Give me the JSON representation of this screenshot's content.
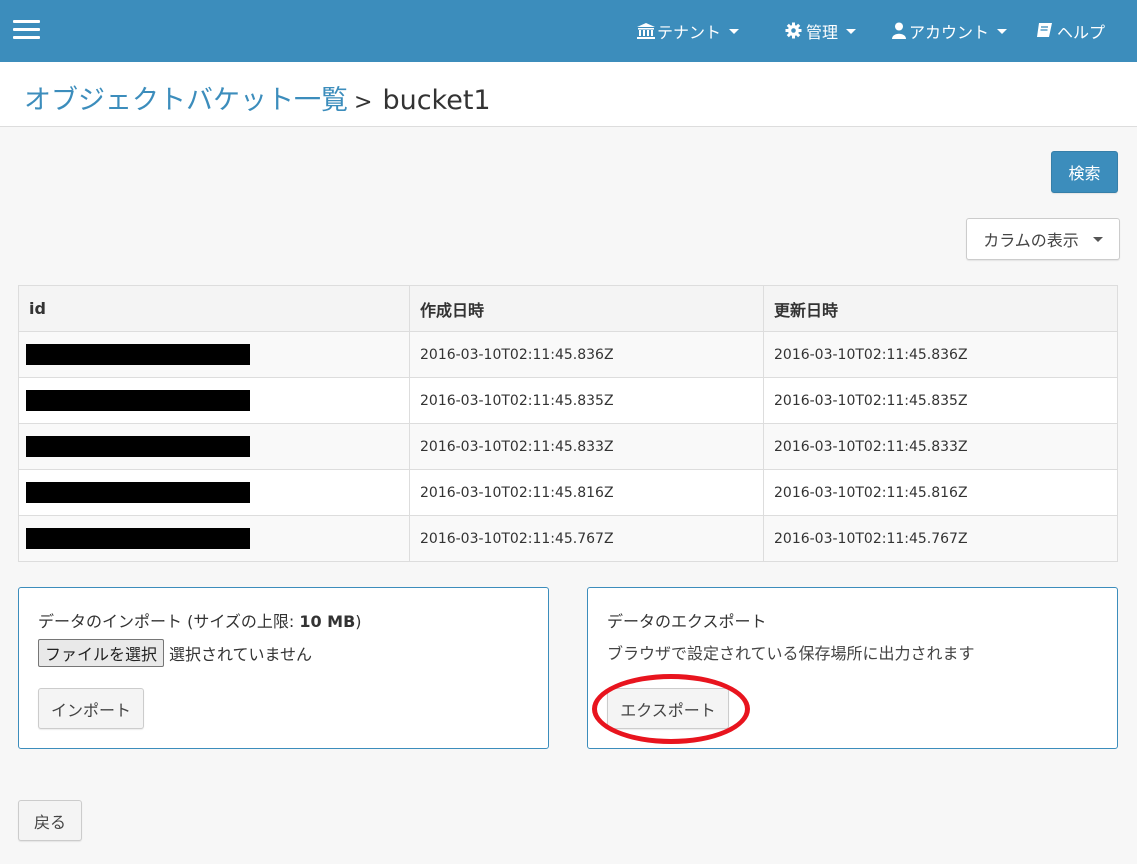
{
  "nav": {
    "tenant": "テナント",
    "admin": "管理",
    "account": "アカウント",
    "help": "ヘルプ"
  },
  "breadcrumb": {
    "parent": "オブジェクトバケット一覧",
    "separator": ">",
    "current": "bucket1"
  },
  "toolbar": {
    "search_label": "検索",
    "columns_label": "カラムの表示"
  },
  "table": {
    "headers": [
      "id",
      "作成日時",
      "更新日時"
    ],
    "rows": [
      {
        "created": "2016-03-10T02:11:45.836Z",
        "updated": "2016-03-10T02:11:45.836Z"
      },
      {
        "created": "2016-03-10T02:11:45.835Z",
        "updated": "2016-03-10T02:11:45.835Z"
      },
      {
        "created": "2016-03-10T02:11:45.833Z",
        "updated": "2016-03-10T02:11:45.833Z"
      },
      {
        "created": "2016-03-10T02:11:45.816Z",
        "updated": "2016-03-10T02:11:45.816Z"
      },
      {
        "created": "2016-03-10T02:11:45.767Z",
        "updated": "2016-03-10T02:11:45.767Z"
      }
    ]
  },
  "import_panel": {
    "title_main": "データのインポート (サイズの上限: ",
    "title_limit": "10 MB",
    "title_close": ")",
    "file_button": "ファイルを選択",
    "file_status": "選択されていません",
    "import_button": "インポート"
  },
  "export_panel": {
    "title": "データのエクスポート",
    "description": "ブラウザで設定されている保存場所に出力されます",
    "export_button": "エクスポート"
  },
  "back_button": "戻る",
  "colors": {
    "brand": "#3c8dbc",
    "highlight": "#e8141e"
  }
}
